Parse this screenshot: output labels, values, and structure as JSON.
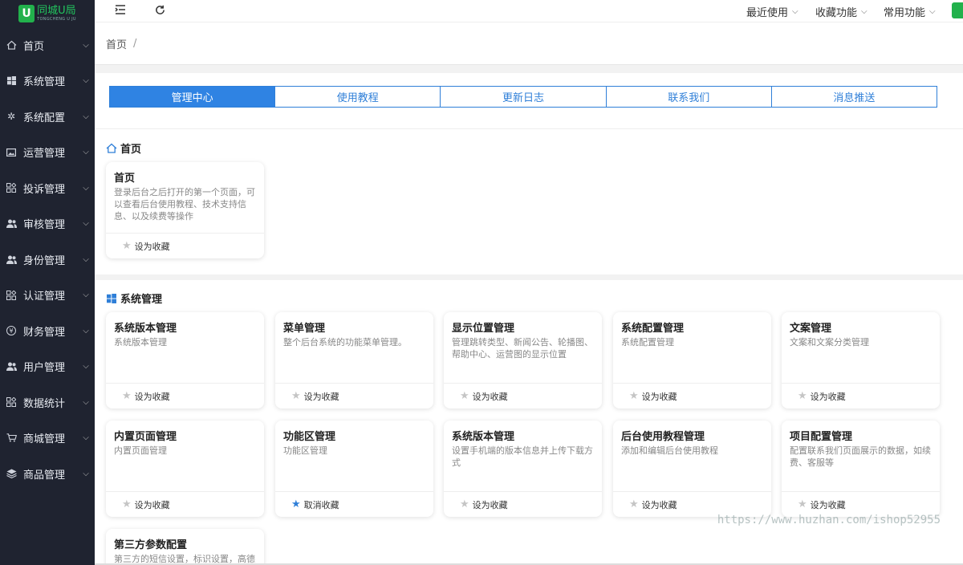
{
  "logo": {
    "mark": "U",
    "name": "同城U局",
    "sub": "TONGCHENG U JU"
  },
  "sidebar": {
    "items": [
      {
        "label": "首页",
        "icon": "home-icon"
      },
      {
        "label": "系统管理",
        "icon": "windows-icon"
      },
      {
        "label": "系统配置",
        "icon": "gear-icon"
      },
      {
        "label": "运营管理",
        "icon": "image-icon"
      },
      {
        "label": "投诉管理",
        "icon": "apps-icon"
      },
      {
        "label": "审核管理",
        "icon": "users-icon"
      },
      {
        "label": "身份管理",
        "icon": "users-icon"
      },
      {
        "label": "认证管理",
        "icon": "apps-icon"
      },
      {
        "label": "财务管理",
        "icon": "yen-icon"
      },
      {
        "label": "用户管理",
        "icon": "users-icon"
      },
      {
        "label": "数据统计",
        "icon": "apps-icon"
      },
      {
        "label": "商城管理",
        "icon": "cart-icon"
      },
      {
        "label": "商品管理",
        "icon": "layers-icon"
      }
    ]
  },
  "header": {
    "menus": [
      {
        "label": "最近使用"
      },
      {
        "label": "收藏功能"
      },
      {
        "label": "常用功能"
      }
    ]
  },
  "breadcrumb": {
    "current": "首页",
    "sep": "/"
  },
  "tabs": [
    {
      "label": "管理中心",
      "active": true
    },
    {
      "label": "使用教程"
    },
    {
      "label": "更新日志"
    },
    {
      "label": "联系我们"
    },
    {
      "label": "消息推送"
    }
  ],
  "sections": {
    "home": {
      "title": "首页",
      "cards": [
        {
          "title": "首页",
          "desc": "登录后台之后打开的第一个页面，可以查看后台使用教程、技术支持信息、以及续费等操作",
          "action": "设为收藏"
        }
      ]
    },
    "system": {
      "title": "系统管理",
      "cards": [
        {
          "title": "系统版本管理",
          "desc": "系统版本管理",
          "action": "设为收藏"
        },
        {
          "title": "菜单管理",
          "desc": "整个后台系统的功能菜单管理。",
          "action": "设为收藏"
        },
        {
          "title": "显示位置管理",
          "desc": "管理跳转类型、新闻公告、轮播图、帮助中心、运营图的显示位置",
          "action": "设为收藏"
        },
        {
          "title": "系统配置管理",
          "desc": "系统配置管理",
          "action": "设为收藏"
        },
        {
          "title": "文案管理",
          "desc": "文案和文案分类管理",
          "action": "设为收藏"
        },
        {
          "title": "内置页面管理",
          "desc": "内置页面管理",
          "action": "设为收藏"
        },
        {
          "title": "功能区管理",
          "desc": "功能区管理",
          "action": "取消收藏",
          "favorited": true
        },
        {
          "title": "系统版本管理",
          "desc": "设置手机端的版本信息并上传下载方式",
          "action": "设为收藏"
        },
        {
          "title": "后台使用教程管理",
          "desc": "添加和编辑后台使用教程",
          "action": "设为收藏"
        },
        {
          "title": "项目配置管理",
          "desc": "配置联系我们页面展示的数据，如续费、客服等",
          "action": "设为收藏"
        },
        {
          "title": "第三方参数配置",
          "desc": "第三方的短信设置，标识设置，高德",
          "action": ""
        }
      ]
    }
  },
  "watermark": "https://www.huzhan.com/ishop52955"
}
